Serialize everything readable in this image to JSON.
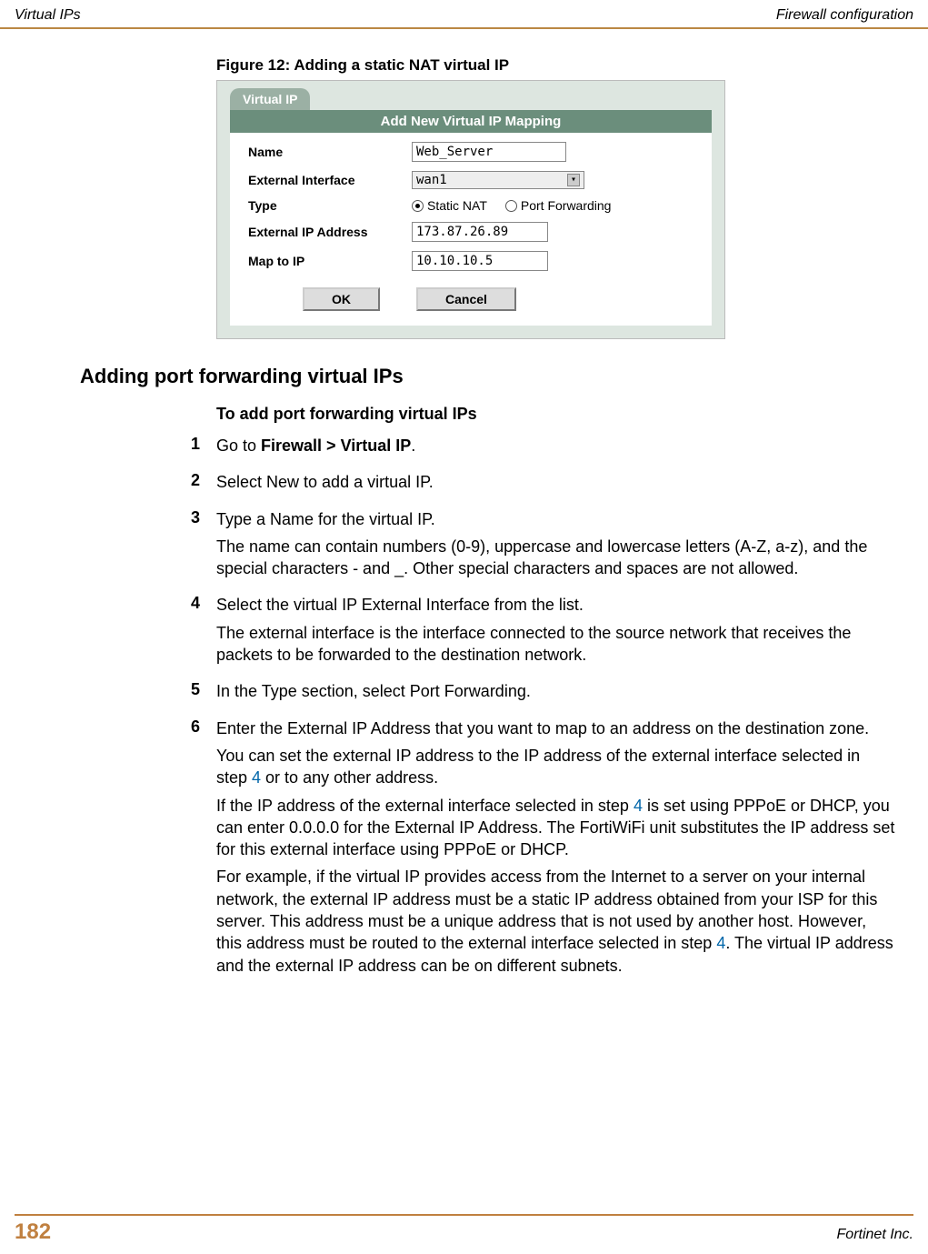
{
  "header": {
    "left": "Virtual IPs",
    "right": "Firewall configuration"
  },
  "figure": {
    "caption": "Figure 12: Adding a static NAT virtual IP",
    "tab_label": "Virtual IP",
    "dialog_title": "Add New Virtual IP Mapping",
    "fields": {
      "name_label": "Name",
      "name_value": "Web_Server",
      "external_interface_label": "External Interface",
      "external_interface_value": "wan1",
      "type_label": "Type",
      "type_options": {
        "static_nat": "Static NAT",
        "port_forwarding": "Port Forwarding"
      },
      "type_selected": "static_nat",
      "external_ip_label": "External IP Address",
      "external_ip_value": "173.87.26.89",
      "map_to_ip_label": "Map to IP",
      "map_to_ip_value": "10.10.10.5"
    },
    "buttons": {
      "ok": "OK",
      "cancel": "Cancel"
    }
  },
  "section": {
    "heading": "Adding port forwarding virtual IPs",
    "subheading": "To add port forwarding virtual IPs",
    "steps": [
      {
        "num": "1",
        "paragraphs": [
          {
            "prefix": "Go to ",
            "bold": "Firewall > Virtual IP",
            "suffix": "."
          }
        ]
      },
      {
        "num": "2",
        "paragraphs": [
          {
            "text": "Select New to add a virtual IP."
          }
        ]
      },
      {
        "num": "3",
        "paragraphs": [
          {
            "text": "Type a Name for the virtual IP."
          },
          {
            "text": "The name can contain numbers (0-9), uppercase and lowercase letters (A-Z, a-z), and the special characters - and _. Other special characters and spaces are not allowed."
          }
        ]
      },
      {
        "num": "4",
        "paragraphs": [
          {
            "text": "Select the virtual IP External Interface from the list."
          },
          {
            "text": "The external interface is the interface connected to the source network that receives the packets to be forwarded to the destination network."
          }
        ]
      },
      {
        "num": "5",
        "paragraphs": [
          {
            "text": "In the Type section, select Port Forwarding."
          }
        ]
      },
      {
        "num": "6",
        "paragraphs": [
          {
            "text": "Enter the External IP Address that you want to map to an address on the destination zone."
          },
          {
            "pre": "You can set the external IP address to the IP address of the external interface selected in step ",
            "ref": "4",
            "post": " or to any other address."
          },
          {
            "pre": "If the IP address of the external interface selected in step ",
            "ref": "4",
            "post": " is set using PPPoE or DHCP, you can enter 0.0.0.0 for the External IP Address. The FortiWiFi unit substitutes the IP address set for this external interface using PPPoE or DHCP."
          },
          {
            "pre": "For example, if the virtual IP provides access from the Internet to a server on your internal network, the external IP address must be a static IP address obtained from your ISP for this server. This address must be a unique address that is not used by another host. However, this address must be routed to the external interface selected in step ",
            "ref": "4",
            "post": ". The virtual IP address and the external IP address can be on different subnets."
          }
        ]
      }
    ]
  },
  "footer": {
    "page": "182",
    "right": "Fortinet Inc."
  }
}
